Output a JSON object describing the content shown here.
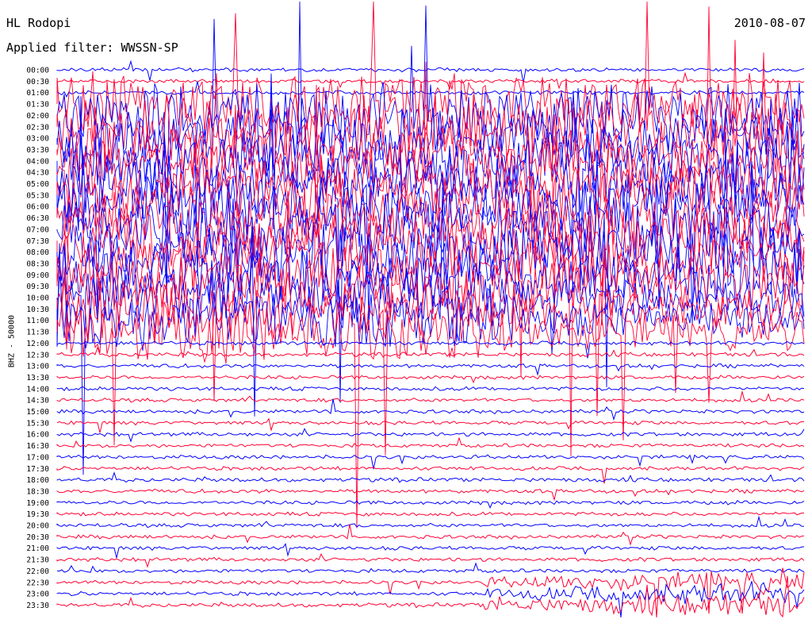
{
  "header": {
    "station": "HL Rodopi",
    "filter": "Applied filter: WWSSN-SP",
    "date": "2010-08-07",
    "channel": "BHZ - 50000"
  },
  "chart_data": {
    "type": "line",
    "title": "HL Rodopi",
    "ylabel": "BHZ - 50000",
    "grid": false,
    "trace_colors": [
      "#0000ff",
      "#ff0033"
    ],
    "rows": [
      "00:00",
      "00:30",
      "01:00",
      "01:30",
      "02:00",
      "02:30",
      "03:00",
      "03:30",
      "04:00",
      "04:30",
      "05:00",
      "05:30",
      "06:00",
      "06:30",
      "07:00",
      "07:30",
      "08:00",
      "08:30",
      "09:00",
      "09:30",
      "10:00",
      "10:30",
      "11:00",
      "11:30",
      "12:00",
      "12:30",
      "13:00",
      "13:30",
      "14:00",
      "14:30",
      "15:00",
      "15:30",
      "16:00",
      "16:30",
      "17:00",
      "17:30",
      "18:00",
      "18:30",
      "19:00",
      "19:30",
      "20:00",
      "20:30",
      "21:00",
      "21:30",
      "22:00",
      "22:30",
      "23:00",
      "23:30"
    ]
  }
}
